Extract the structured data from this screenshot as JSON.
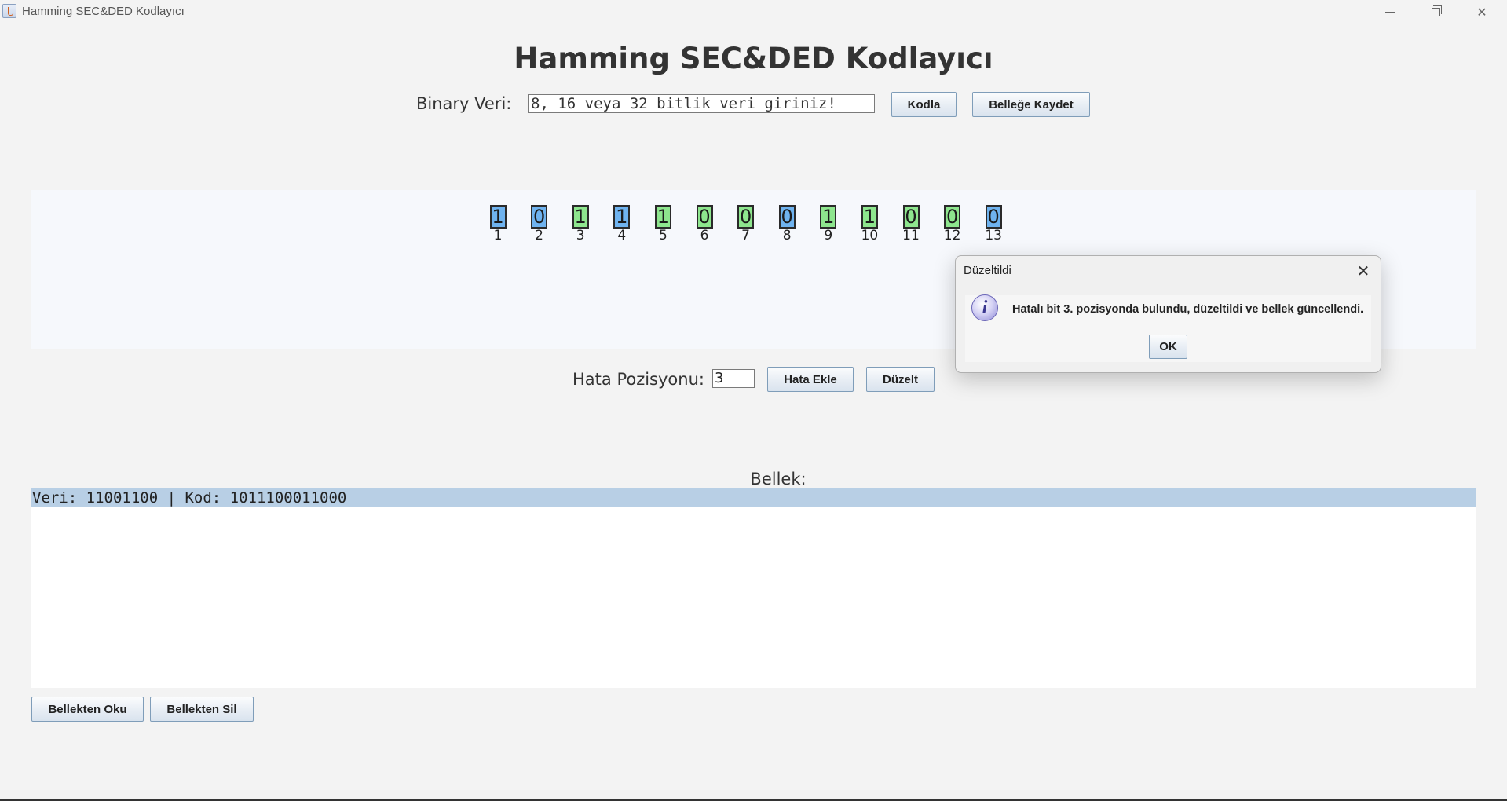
{
  "window": {
    "title": "Hamming SEC&DED Kodlayıcı",
    "controls": {
      "minimize_icon": "minimize-icon",
      "maximize_icon": "restore-icon",
      "close_icon": "close-icon"
    }
  },
  "header": {
    "title": "Hamming SEC&DED Kodlayıcı"
  },
  "input_row": {
    "label": "Binary Veri:",
    "value": "8, 16 veya 32 bitlik veri giriniz!",
    "kodla_label": "Kodla",
    "kaydet_label": "Belleğe Kaydet"
  },
  "bits": [
    {
      "value": "1",
      "index": "1",
      "type": "parity"
    },
    {
      "value": "0",
      "index": "2",
      "type": "parity"
    },
    {
      "value": "1",
      "index": "3",
      "type": "data"
    },
    {
      "value": "1",
      "index": "4",
      "type": "parity"
    },
    {
      "value": "1",
      "index": "5",
      "type": "data"
    },
    {
      "value": "0",
      "index": "6",
      "type": "data"
    },
    {
      "value": "0",
      "index": "7",
      "type": "data"
    },
    {
      "value": "0",
      "index": "8",
      "type": "parity"
    },
    {
      "value": "1",
      "index": "9",
      "type": "data"
    },
    {
      "value": "1",
      "index": "10",
      "type": "data"
    },
    {
      "value": "0",
      "index": "11",
      "type": "data"
    },
    {
      "value": "0",
      "index": "12",
      "type": "data"
    },
    {
      "value": "0",
      "index": "13",
      "type": "parity"
    }
  ],
  "colors": {
    "parity": "#6fb3ef",
    "data": "#8ee68e",
    "selected_row": "#b8cfe5"
  },
  "error_row": {
    "label": "Hata Pozisyonu:",
    "value": "3",
    "hata_ekle_label": "Hata Ekle",
    "duzelt_label": "Düzelt"
  },
  "memory": {
    "label": "Bellek:",
    "items": [
      "Veri: 11001100 | Kod: 1011100011000"
    ],
    "oku_label": "Bellekten Oku",
    "sil_label": "Bellekten Sil"
  },
  "dialog": {
    "title": "Düzeltildi",
    "icon": "info-icon",
    "message": "Hatalı bit 3. pozisyonda bulundu, düzeltildi ve bellek güncellendi.",
    "ok_label": "OK"
  }
}
